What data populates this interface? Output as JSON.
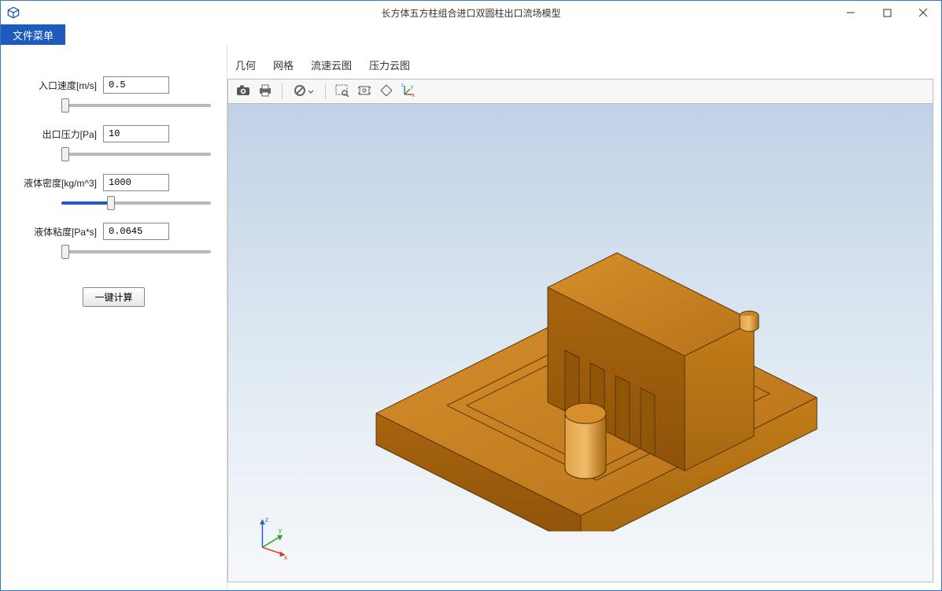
{
  "window": {
    "title": "长方体五方柱组合进口双圆柱出口流场模型"
  },
  "menubar": {
    "file_menu": "文件菜单"
  },
  "sidebar": {
    "params": {
      "inlet_velocity": {
        "label": "入口速度[m/s]",
        "value": "0.5"
      },
      "outlet_pressure": {
        "label": "出口压力[Pa]",
        "value": "10"
      },
      "fluid_density": {
        "label": "液体密度[kg/m^3]",
        "value": "1000"
      },
      "fluid_viscosity": {
        "label": "液体粘度[Pa*s]",
        "value": "0.0645"
      }
    },
    "calculate_label": "一键计算"
  },
  "tabs": {
    "geometry": "几何",
    "mesh": "网格",
    "velocity_contour": "流速云图",
    "pressure_contour": "压力云图"
  },
  "toolbar_icons": {
    "camera": "camera",
    "print": "print",
    "cancel": "cancel",
    "zoom_box": "zoom-box",
    "fit_all": "fit-all",
    "reset_view": "reset-view",
    "axis_toggle": "axis-toggle"
  },
  "axis": {
    "x": "x",
    "y": "y",
    "z": "z"
  },
  "colors": {
    "accent": "#1e5bbf",
    "model_fill": "#c17a16",
    "model_edge": "#5a3508"
  }
}
